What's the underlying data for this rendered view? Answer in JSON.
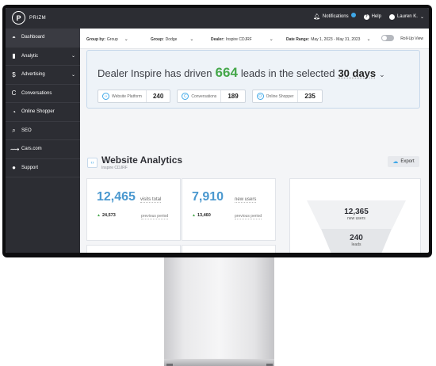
{
  "topbar": {
    "logo_text": "PRIZM",
    "notifications_label": "Notifications",
    "help_label": "Help",
    "user_label": "Lauren K."
  },
  "sidebar": {
    "items": [
      {
        "label": "Dashboard",
        "icon": "gauge-icon"
      },
      {
        "label": "Analytic",
        "icon": "bar-chart-icon",
        "has_chevron": true
      },
      {
        "label": "Advertising",
        "icon": "dollar-icon",
        "has_chevron": true
      },
      {
        "label": "Conversations",
        "icon": "conversation-c-icon"
      },
      {
        "label": "Online Shopper",
        "icon": "online-shopper-icon"
      },
      {
        "label": "SEO",
        "icon": "seo-search-icon"
      },
      {
        "label": "Cars.com",
        "icon": "car-icon"
      },
      {
        "label": "Support",
        "icon": "person-icon"
      }
    ]
  },
  "filters": {
    "group_by_label": "Group by:",
    "group_by_value": "Group",
    "group_label": "Group:",
    "group_value": "Dodge",
    "dealer_label": "Dealer:",
    "dealer_value": "Inspire CDJRF",
    "date_range_label": "Date Range:",
    "date_range_value": "May 1, 2023 - May 31, 2023",
    "rollup_label": "Roll-Up View"
  },
  "hero": {
    "prefix": "Dealer Inspire has driven",
    "leads": "664",
    "middle": "leads in the selected",
    "period": "30 days",
    "chips": [
      {
        "label": "Website Platform",
        "value": "240",
        "icon": "code-icon"
      },
      {
        "label": "Conversations",
        "value": "189",
        "icon": "conversation-c-icon"
      },
      {
        "label": "Online Shopper",
        "value": "235",
        "icon": "online-shopper-icon"
      }
    ]
  },
  "analytics": {
    "title": "Website Analytics",
    "subtitle": "Inspire CDJRF",
    "export_label": "Export",
    "stats": [
      {
        "value": "12,465",
        "unit": "visits total",
        "previous": "24,573",
        "previous_label": "previous period"
      },
      {
        "value": "7,910",
        "unit": "new users",
        "previous": "13,460",
        "previous_label": "previous period"
      }
    ],
    "funnel": [
      {
        "value": "12,365",
        "label": "new users"
      },
      {
        "value": "240",
        "label": "leads"
      }
    ]
  },
  "colors": {
    "sidebar_bg": "#2c2d33",
    "accent_blue": "#3fa8e8",
    "leads_green": "#45a74a",
    "stat_blue": "#4a98cf"
  }
}
